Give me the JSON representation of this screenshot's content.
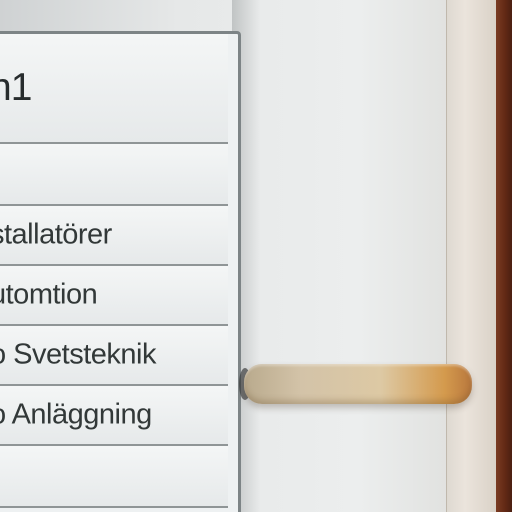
{
  "label_rows": [
    "n1",
    "",
    "stallatörer",
    "utomtion",
    "o Svetsteknik",
    "o Anläggning",
    ""
  ]
}
